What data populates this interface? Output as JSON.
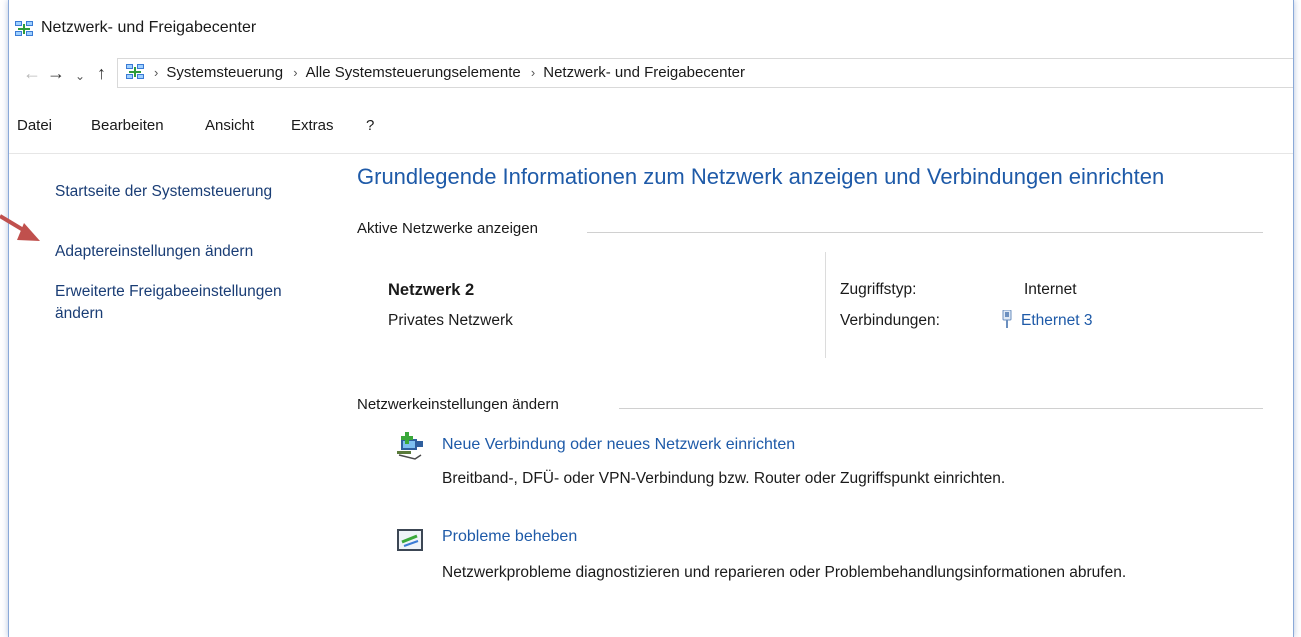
{
  "window": {
    "title": "Netzwerk- und Freigabecenter"
  },
  "navigation": {
    "back_icon": "arrow-left-icon",
    "forward_icon": "arrow-right-icon",
    "recent_icon": "chevron-down-icon",
    "up_icon": "arrow-up-icon",
    "breadcrumbs": [
      "Systemsteuerung",
      "Alle Systemsteuerungselemente",
      "Netzwerk- und Freigabecenter"
    ]
  },
  "menu": {
    "items": [
      "Datei",
      "Bearbeiten",
      "Ansicht",
      "Extras",
      "?"
    ]
  },
  "sidebar": {
    "links": [
      "Startseite der Systemsteuerung",
      "Adaptereinstellungen ändern",
      "Erweiterte Freigabeeinstellungen ändern"
    ]
  },
  "main": {
    "title": "Grundlegende Informationen zum Netzwerk anzeigen und Verbindungen einrichten",
    "active_networks": {
      "heading": "Aktive Netzwerke anzeigen",
      "network_name": "Netzwerk 2",
      "network_type": "Privates Netzwerk",
      "access_type_label": "Zugriffstyp:",
      "access_type_value": "Internet",
      "connections_label": "Verbindungen:",
      "connection_value": "Ethernet 3"
    },
    "change_settings": {
      "heading": "Netzwerkeinstellungen ändern",
      "tasks": [
        {
          "link": "Neue Verbindung oder neues Netzwerk einrichten",
          "description": "Breitband-, DFÜ- oder VPN-Verbindung bzw. Router oder Zugriffspunkt einrichten.",
          "icon": "new-connection-icon"
        },
        {
          "link": "Probleme beheben",
          "description": "Netzwerkprobleme diagnostizieren und reparieren oder Problembehandlungsinformationen abrufen.",
          "icon": "troubleshoot-icon"
        }
      ]
    }
  },
  "colors": {
    "link": "#1e5aa8",
    "sidebar_link": "#1a3d75",
    "annotation_arrow": "#c0504d"
  }
}
